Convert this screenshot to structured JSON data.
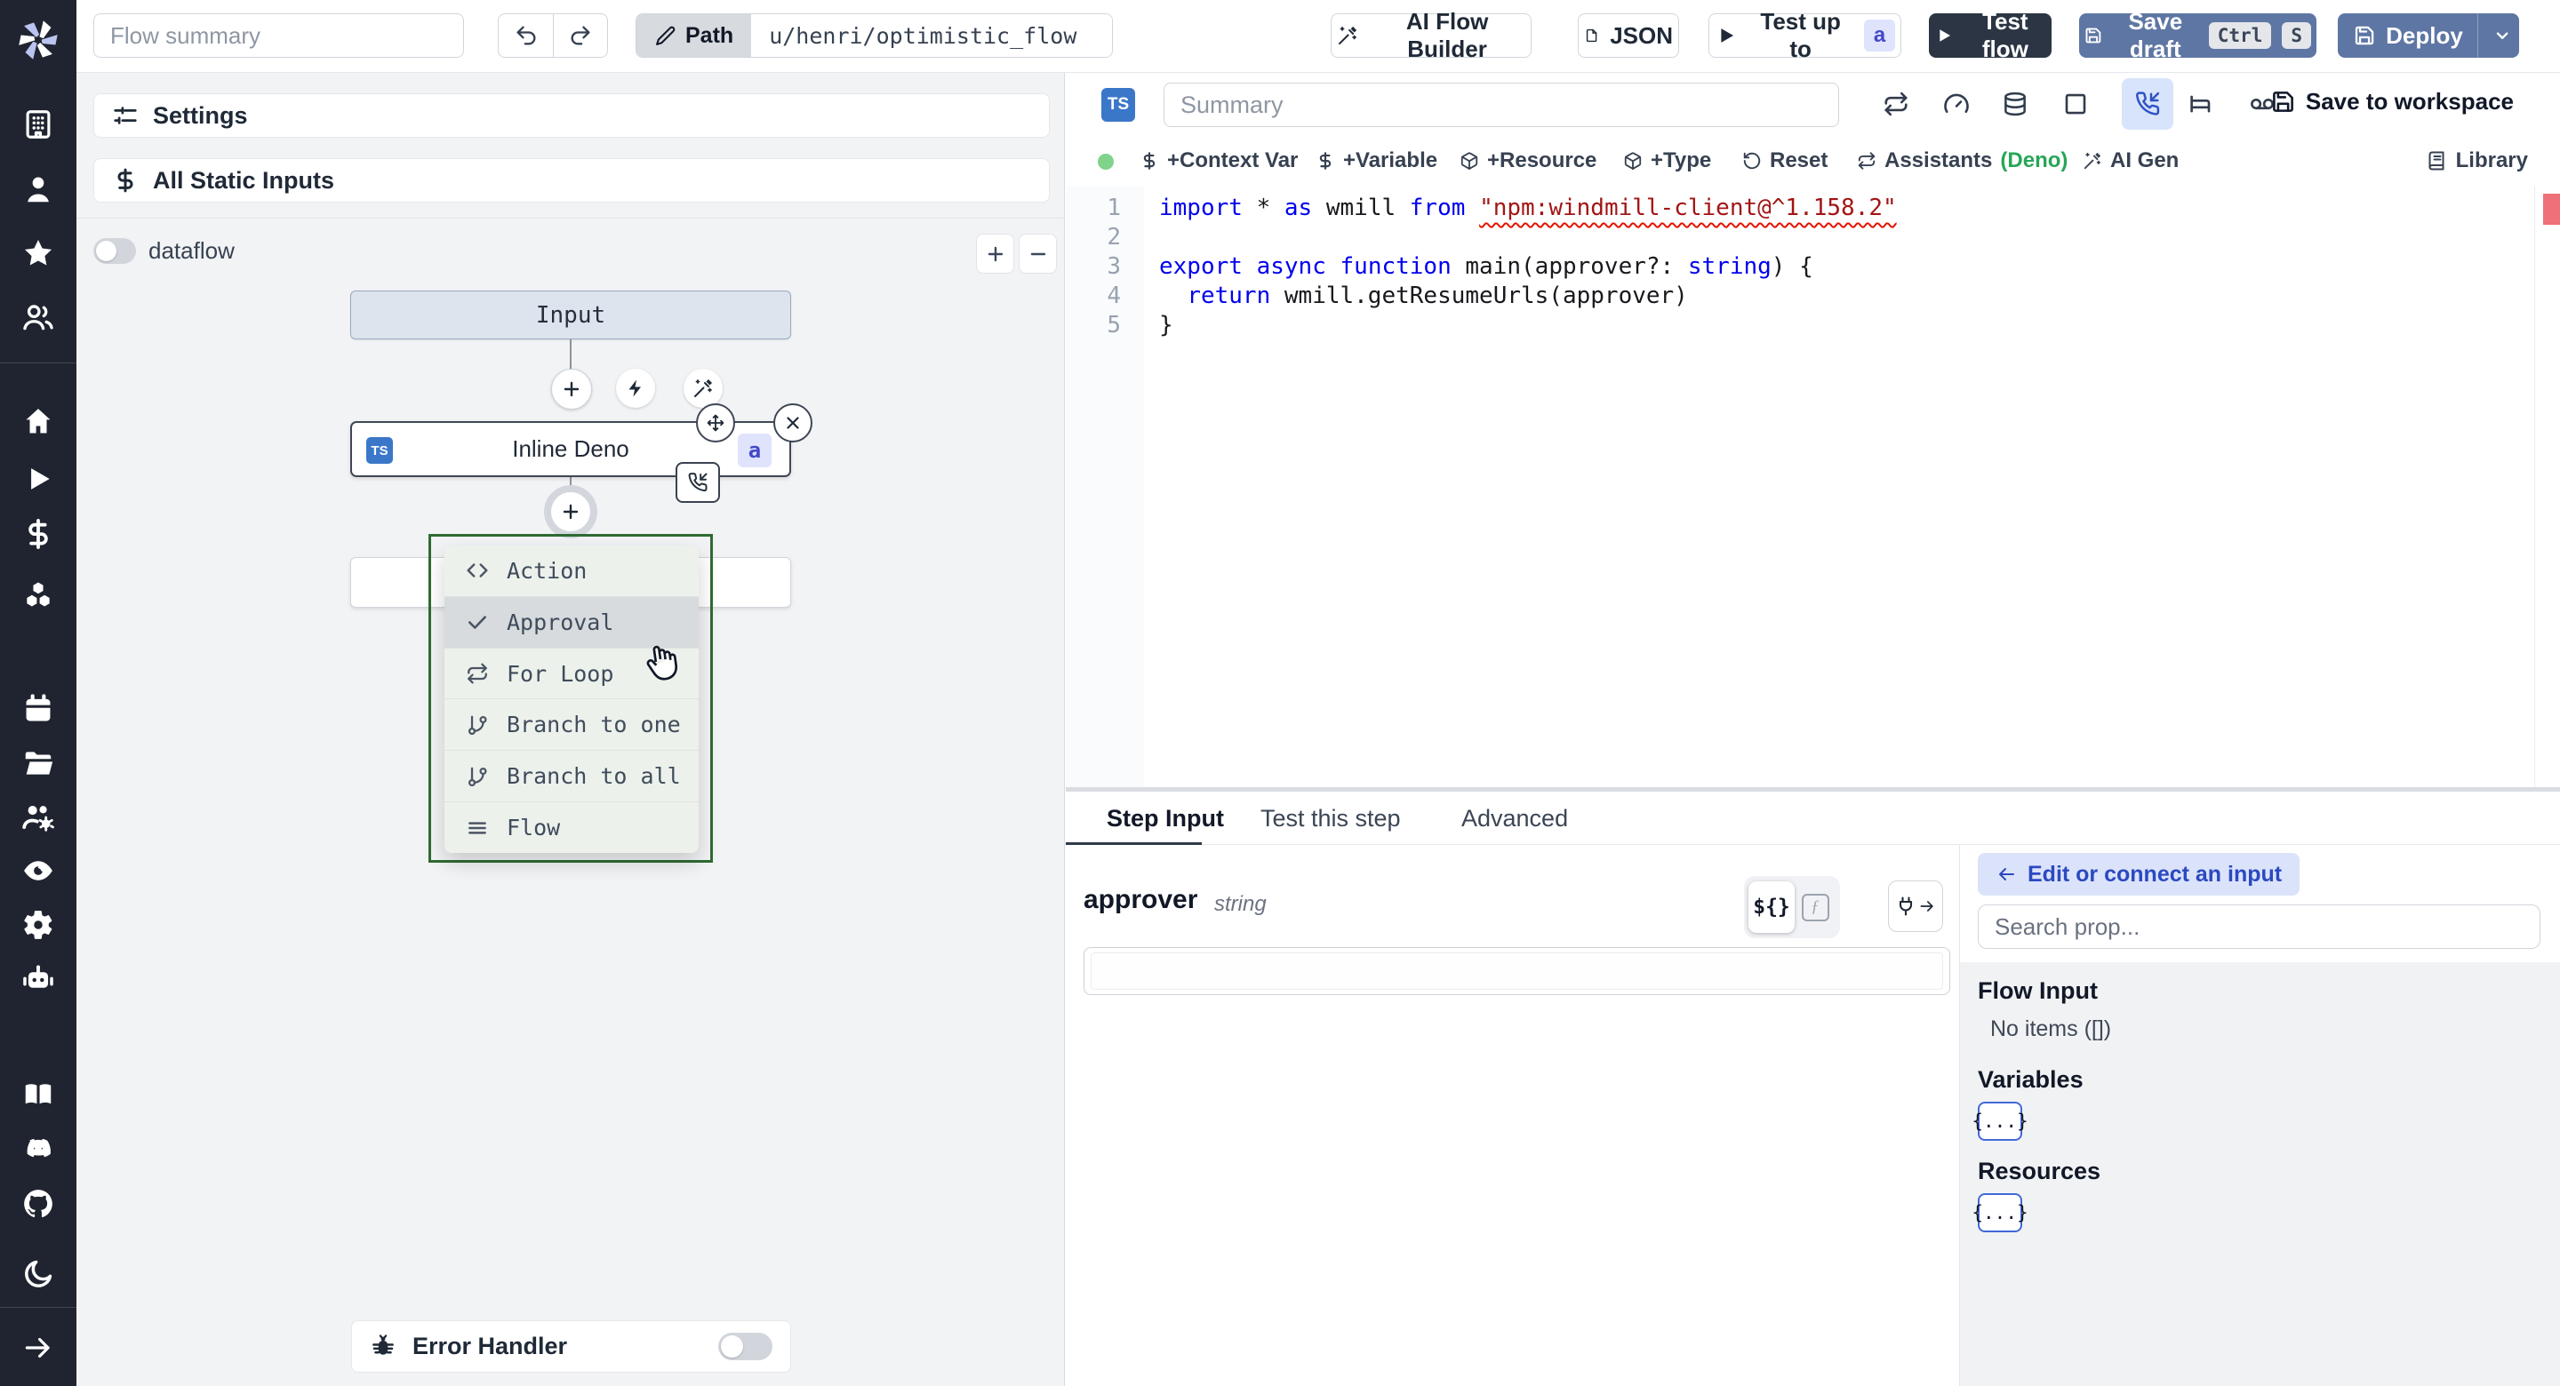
{
  "colors": {
    "sidebar_bg": "#1f2430",
    "accent_blue": "#3b77c9",
    "primary_button": "#5e76a4",
    "dark_button": "#2b3544",
    "menu_border_green": "#2f6b33",
    "badge_indigo_bg": "#dfe3fc",
    "badge_indigo_text": "#4348ca",
    "code_keyword": "#0000ee",
    "code_string": "#a31515",
    "status_green": "#7fd38a",
    "link_blue": "#2b49c0"
  },
  "topbar": {
    "flow_summary_placeholder": "Flow summary",
    "undo_icon": "undo",
    "redo_icon": "redo",
    "path_icon": "pencil",
    "path_label": "Path",
    "path_value": "u/henri/optimistic_flow",
    "buttons": {
      "ai_flow_builder": {
        "icon": "wand",
        "label": "AI Flow Builder"
      },
      "json": {
        "icon": "file",
        "label": "JSON"
      },
      "test_up_to": {
        "icon": "play",
        "label": "Test up to",
        "badge": "a"
      },
      "test_flow": {
        "icon": "play",
        "label": "Test flow"
      },
      "save_draft": {
        "icon": "save",
        "label": "Save draft",
        "kbd": [
          "Ctrl",
          "S"
        ]
      },
      "deploy": {
        "icon": "save",
        "label": "Deploy",
        "chevron_icon": "chevron-down"
      }
    }
  },
  "sidebar": {
    "logo_icon": "windmill",
    "items": [
      {
        "icon": "building",
        "name": "workspace"
      },
      {
        "icon": "user",
        "name": "user"
      },
      {
        "icon": "star",
        "name": "favorites"
      },
      {
        "icon": "users",
        "name": "groups"
      },
      {
        "icon": "home",
        "name": "home"
      },
      {
        "icon": "play",
        "name": "runs"
      },
      {
        "icon": "dollar",
        "name": "variables"
      },
      {
        "icon": "boxes",
        "name": "resources"
      },
      {
        "icon": "calendar",
        "name": "schedules"
      },
      {
        "icon": "folder",
        "name": "folders"
      },
      {
        "icon": "users-cog",
        "name": "workers"
      },
      {
        "icon": "eye",
        "name": "audit-logs"
      },
      {
        "icon": "gear",
        "name": "instance-settings"
      },
      {
        "icon": "bot",
        "name": "ai"
      },
      {
        "icon": "book",
        "name": "docs"
      },
      {
        "icon": "discord",
        "name": "discord"
      },
      {
        "icon": "github",
        "name": "github"
      },
      {
        "icon": "moon",
        "name": "dark-mode"
      },
      {
        "icon": "arrow-right",
        "name": "expand-sidebar"
      }
    ]
  },
  "flow_panel": {
    "settings": {
      "icon": "sliders",
      "label": "Settings"
    },
    "static_inputs": {
      "icon": "dollar",
      "label": "All Static Inputs"
    },
    "dataflow_label": "dataflow",
    "zoom_in_icon": "plus",
    "zoom_out_icon": "minus",
    "input_node_label": "Input",
    "node_actions": [
      {
        "icon": "plus",
        "name": "add-step"
      },
      {
        "icon": "zap",
        "name": "add-trigger"
      },
      {
        "icon": "wand",
        "name": "ai-suggest"
      }
    ],
    "step_node": {
      "badge": "TS",
      "label": "Inline Deno",
      "suffix_badge": "a",
      "move_icon": "move",
      "close_icon": "x",
      "suspend_icon": "phone-incoming"
    },
    "insert_icon": "plus",
    "insert_menu": {
      "items": [
        {
          "icon": "code",
          "label": "Action"
        },
        {
          "icon": "check",
          "label": "Approval",
          "highlight": true
        },
        {
          "icon": "repeat",
          "label": "For Loop"
        },
        {
          "icon": "git-branch",
          "label": "Branch to one"
        },
        {
          "icon": "git-branch",
          "label": "Branch to all"
        },
        {
          "icon": "menu",
          "label": "Flow"
        }
      ]
    },
    "error_handler": {
      "icon": "bug",
      "label": "Error Handler"
    }
  },
  "editor": {
    "lang_badge": "TS",
    "summary_placeholder": "Summary",
    "header_icons": [
      {
        "icon": "repeat",
        "name": "retries"
      },
      {
        "icon": "gauge",
        "name": "early-stop"
      },
      {
        "icon": "database",
        "name": "cache"
      },
      {
        "icon": "square",
        "name": "concurrency"
      },
      {
        "icon": "phone-incoming",
        "name": "suspend-approval",
        "active": true
      },
      {
        "icon": "bed",
        "name": "sleep"
      },
      {
        "icon": "voicemail",
        "name": "mock"
      }
    ],
    "save_to_workspace": {
      "icon": "save",
      "label": "Save to workspace"
    },
    "actions": [
      {
        "icon": "dollar",
        "label": "+Context Var"
      },
      {
        "icon": "dollar",
        "label": "+Variable"
      },
      {
        "icon": "package",
        "label": "+Resource"
      },
      {
        "icon": "package",
        "label": "+Type"
      },
      {
        "icon": "rotate-ccw",
        "label": "Reset"
      },
      {
        "icon": "repeat",
        "label": "Assistants",
        "suffix": "(Deno)"
      },
      {
        "icon": "wand",
        "label": "AI Gen"
      }
    ],
    "library": {
      "icon": "library",
      "label": "Library"
    },
    "code": {
      "lines": [
        {
          "n": "1",
          "tokens": [
            {
              "t": "import",
              "c": "kw"
            },
            {
              "t": " * ",
              "c": "pl"
            },
            {
              "t": "as",
              "c": "kw"
            },
            {
              "t": " wmill ",
              "c": "pl"
            },
            {
              "t": "from",
              "c": "kw"
            },
            {
              "t": " ",
              "c": "pl"
            },
            {
              "t": "\"npm:windmill-client@^1.158.2\"",
              "c": "str sq"
            }
          ]
        },
        {
          "n": "2",
          "tokens": []
        },
        {
          "n": "3",
          "tokens": [
            {
              "t": "export",
              "c": "kw"
            },
            {
              "t": " ",
              "c": "pl"
            },
            {
              "t": "async",
              "c": "kw"
            },
            {
              "t": " ",
              "c": "pl"
            },
            {
              "t": "function",
              "c": "kw"
            },
            {
              "t": " main(approver?: ",
              "c": "pl"
            },
            {
              "t": "string",
              "c": "kw"
            },
            {
              "t": ") {",
              "c": "pl"
            }
          ]
        },
        {
          "n": "4",
          "tokens": [
            {
              "t": "  ",
              "c": "pl"
            },
            {
              "t": "return",
              "c": "kw"
            },
            {
              "t": " wmill.getResumeUrls(approver)",
              "c": "pl"
            }
          ]
        },
        {
          "n": "5",
          "tokens": [
            {
              "t": "}",
              "c": "pl"
            }
          ]
        }
      ]
    }
  },
  "step_panel": {
    "tabs": [
      {
        "label": "Step Input",
        "active": true
      },
      {
        "label": "Test this step"
      },
      {
        "label": "Advanced"
      }
    ],
    "field": {
      "name": "approver",
      "type": "string",
      "value": ""
    },
    "toggle": {
      "expr": "${}",
      "fn": "ƒ"
    },
    "plug_icon": "plug",
    "plug_arrow_icon": "arrow-right"
  },
  "connect_panel": {
    "edit_button": {
      "icon": "arrow-left",
      "label": "Edit or connect an input"
    },
    "search_placeholder": "Search prop...",
    "sections": [
      {
        "title": "Flow Input",
        "text": "No items ([])"
      },
      {
        "title": "Variables",
        "chip": "{...}"
      },
      {
        "title": "Resources",
        "chip": "{...}"
      }
    ]
  }
}
